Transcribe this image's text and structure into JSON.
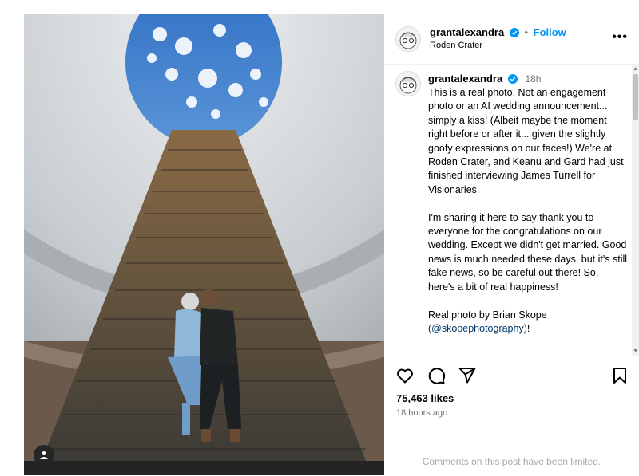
{
  "post": {
    "username": "grantalexandra",
    "follow_label": "Follow",
    "location": "Roden Crater",
    "more_label": "•••",
    "separator": "•"
  },
  "caption": {
    "username": "grantalexandra",
    "time": "18h",
    "text": "This is a real photo. Not an engagement photo or an AI wedding announcement... simply a kiss! (Albeit maybe the moment right before or after it... given the slightly goofy expressions on our faces!) We're at Roden Crater, and Keanu and Gard had just finished interviewing James Turrell for Visionaries.\n\nI'm sharing it here to say thank you to everyone for the congratulations on our wedding. Except we didn't get married. Good news is much needed these days, but it's still fake news, so be careful out there! So, here's a bit of real happiness!\n\nReal photo by Brian Skope\n",
    "mention": "(@skopephotography)",
    "mention_suffix": "!"
  },
  "engagement": {
    "likes": "75,463 likes",
    "posted": "18 hours ago",
    "comments_limited": "Comments on this post have been limited."
  },
  "icons": {
    "like": "heart-icon",
    "comment": "comment-icon",
    "share": "share-icon",
    "save": "bookmark-icon",
    "tag": "user-tag-icon",
    "verified": "verified-badge-icon"
  },
  "colors": {
    "accent": "#0095f6",
    "verified": "#0095f6",
    "muted": "#737373",
    "limited_text": "#a8a8a8"
  }
}
